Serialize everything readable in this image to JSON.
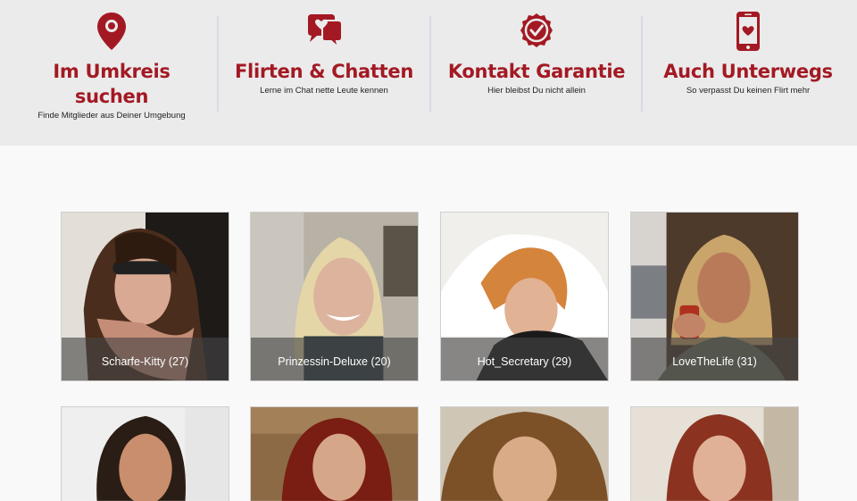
{
  "features": [
    {
      "icon": "map-pin-icon",
      "title_line1": "Im Umkreis",
      "title_line2": "suchen",
      "subtitle": "Finde Mitglieder aus Deiner Umgebung"
    },
    {
      "icon": "chat-heart-icon",
      "title_line1": "Flirten & Chatten",
      "title_line2": "",
      "subtitle": "Lerne im Chat nette Leute kennen"
    },
    {
      "icon": "verified-badge-icon",
      "title_line1": "Kontakt Garantie",
      "title_line2": "",
      "subtitle": "Hier bleibst Du nicht allein"
    },
    {
      "icon": "phone-heart-icon",
      "title_line1": "Auch Unterwegs",
      "title_line2": "",
      "subtitle": "So verpasst Du keinen Flirt mehr"
    }
  ],
  "accent_color": "#a31923",
  "profiles": [
    {
      "label": "Scharfe-Kitty (27)"
    },
    {
      "label": "Prinzessin-Deluxe (20)"
    },
    {
      "label": "Hot_Secretary (29)"
    },
    {
      "label": "LoveTheLife (31)"
    },
    {
      "label": ""
    },
    {
      "label": ""
    },
    {
      "label": ""
    },
    {
      "label": ""
    }
  ]
}
